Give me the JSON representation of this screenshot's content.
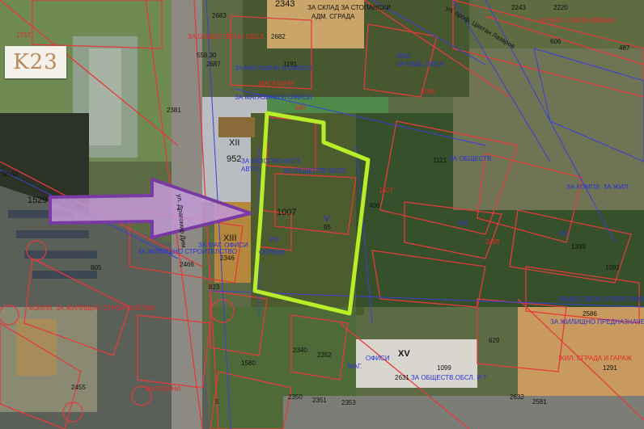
{
  "logo": {
    "text": "K23"
  },
  "colors": {
    "highlight": "#b7ee28",
    "arrow": "#9b59c7",
    "plot_lines": "#e33b3b",
    "cadastre_lines": "#3b3fd8"
  },
  "labels": {
    "l2343": "2343",
    "lsklad": "ЗА СКЛАД ЗА СТОПАНСКИ",
    "ladm": "АДМ. СГРАДА",
    "lprof": "ул. проф. Цветан Лазаров",
    "l2243": "2243",
    "l2220": "2220",
    "lzel": "ЗА ЖИЛ. ОЗЕЛЕНЯВАНЕ",
    "l1767": "1767",
    "l2683": "2683",
    "l2682": "2682",
    "lobsh1": "ЗА ОБЩЕСТВЕНО ОБСЛ.",
    "l606": "606",
    "l487": "487",
    "l1191": "1191",
    "lmag1": "ЗА МАГАЗИНИ И ОФИСИ",
    "l2001": "2001",
    "lobsh2": "ЗА ОБЩ. ОБСЛ.",
    "l558": "558.30",
    "l2687": "2687",
    "lmag2": "ЗА МАГАЗИНИ И ОФИСИ",
    "l189": "189",
    "lmaz": "МАГАЗИНИ",
    "l2090": "2090",
    "l2381": "2381",
    "lxii": "XII",
    "l952": "952",
    "lbezn": "ЗА БЕЗОПАСНОСТ",
    "lavto": "АВТО",
    "lobshobs": "ЗА ОБЩЕСТВ.ОБСЛ.",
    "l1121": "1121",
    "lzaobsh": "ЗА ОБЩЕСТВ.",
    "l1407": "1407",
    "lstreet": "ул. Драгомир Дим.",
    "l1007": "1007",
    "l406": "406",
    "l95": "95",
    "lv": "V",
    "lvii": "VIII",
    "lxiv": "XIV",
    "lxvi": "XVI",
    "lxiii": "XIII",
    "lofisi": "ЗА МАГ. ОФИСИ",
    "lobsl": "ЗА ЖИЛИЩНО СТРОИТЕЛСТВО",
    "l2346": "2346",
    "l2466": "2466",
    "lserv": "СЕРВИЗ",
    "l2489": "2489",
    "l1399": "1399",
    "l805": "805",
    "l823": "823",
    "lkompl": "КОМПЛ. ЗА ЖИЛИЩНО СТРОИТЕЛСТВО",
    "lbl42": "бл.42",
    "l1529": "1529",
    "l2340": "2340",
    "l2352": "2352",
    "lmag": "МАГ.",
    "lofisi2": "ОФИСИ",
    "lxv": "XV",
    "l2631": "2631",
    "lzaobs": "ЗА ОБЩЕСТВ.ОБСЛ. И Т",
    "l1099": "1099",
    "l1580": "1580",
    "l2350": "2350",
    "l2351": "2351",
    "l2353": "2353",
    "l2632": "2632",
    "l2581": "2581",
    "l2455": "2455",
    "lzhil": "ЗА ЖИЛИЩНО ПРЕДНАЗНАЧЕНИЕ",
    "lzhil2": "ЖИЛ. СГРАДА И ГАРАЖ",
    "l1291": "1291",
    "l2586": "2586",
    "l629": "629",
    "lmagaz": "МАГАЗИНИ",
    "lobpol": "ОБЩЕСТВЕНО-ПОЛИТИЧЕСКИ",
    "l1092": "1092",
    "lzakomp": "ЗА КОМПЛ. ЗА ЖИЛ.",
    "l2351b": "2351",
    "l5": "5"
  }
}
